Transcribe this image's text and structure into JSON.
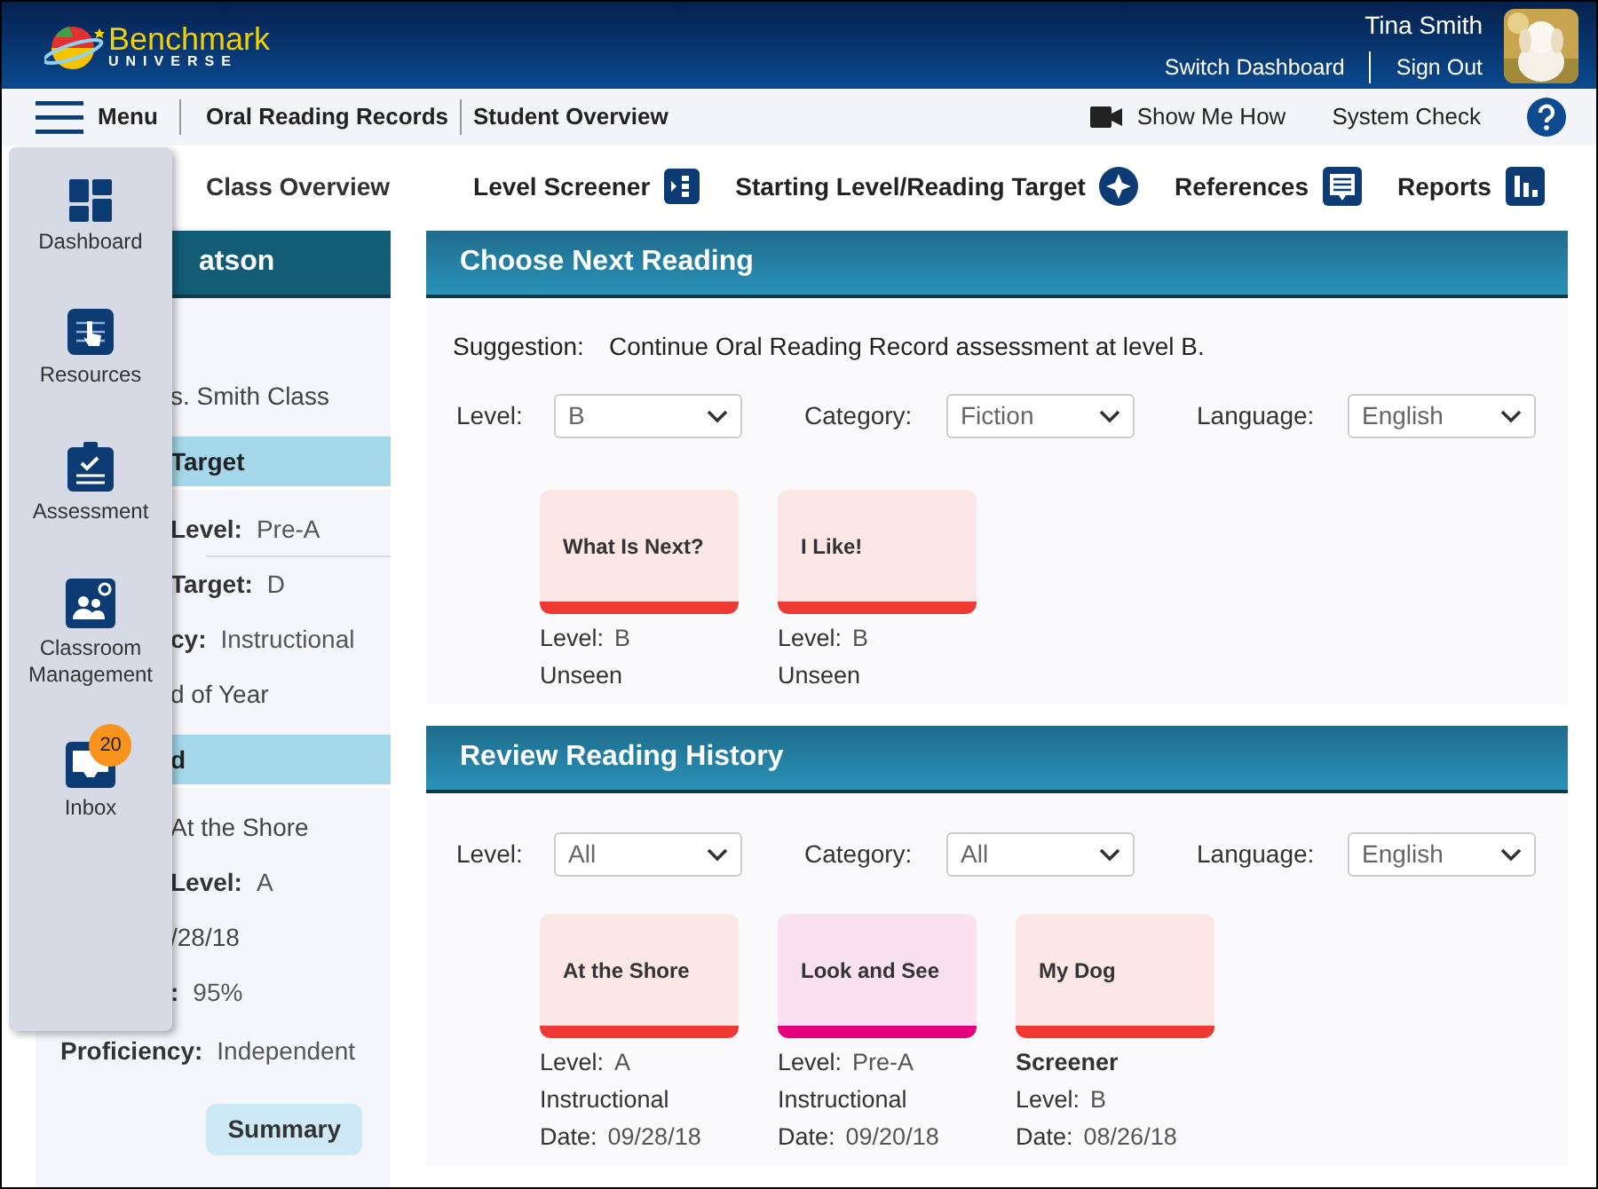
{
  "logo": {
    "word": "Benchmark",
    "subword": "UNIVERSE"
  },
  "user": {
    "name": "Tina Smith",
    "links": [
      "Switch Dashboard",
      "Sign Out"
    ],
    "avatar": {
      "kind": "picture"
    }
  },
  "nav": {
    "menu_label": "Menu",
    "breadcrumbs": [
      "Oral Reading Records",
      "Student Overview"
    ],
    "right": [
      {
        "kind": "video",
        "label": "Show Me How"
      },
      {
        "kind": "plain",
        "label": "System Check"
      },
      {
        "kind": "help"
      }
    ]
  },
  "toolbar": {
    "back": "Class Overview",
    "tools": [
      {
        "label": "Level Screener"
      },
      {
        "label": "Starting Level/Reading Target"
      },
      {
        "label": "References"
      },
      {
        "label": "Reports"
      }
    ]
  },
  "side_menu": [
    {
      "label": "Dashboard"
    },
    {
      "label": "Resources"
    },
    {
      "label": "Assessment"
    },
    {
      "label": "Classroom Management"
    },
    {
      "label": "Inbox",
      "badge": "20"
    }
  ],
  "student_panel": [
    {
      "kind": "header",
      "text": "atson"
    },
    {
      "kind": "text",
      "text": "s. Smith Class"
    },
    {
      "kind": "band",
      "text": "Target"
    },
    {
      "kind": "field",
      "label": "Level:",
      "value": "Pre-A",
      "divider": true
    },
    {
      "kind": "field",
      "label": "Target:",
      "value": "D"
    },
    {
      "kind": "field",
      "label": "cy:",
      "value": "Instructional"
    },
    {
      "kind": "text",
      "text": "d of Year"
    },
    {
      "kind": "band",
      "text": "d"
    },
    {
      "kind": "text",
      "text": "At the Shore"
    },
    {
      "kind": "field",
      "label": "Level:",
      "value": "A"
    },
    {
      "kind": "text",
      "text": "/28/18"
    },
    {
      "kind": "field",
      "label": ":",
      "value": "95%"
    },
    {
      "kind": "field",
      "label": "Proficiency:",
      "value": "Independent",
      "full": true
    },
    {
      "kind": "button",
      "text": "Summary"
    }
  ],
  "sections": [
    {
      "title": "Choose Next Reading",
      "suggestion": {
        "label": "Suggestion:",
        "text": "Continue Oral Reading Record assessment at level B."
      },
      "filters": [
        {
          "label": "Level:",
          "value": "B"
        },
        {
          "label": "Category:",
          "value": "Fiction"
        },
        {
          "label": "Language:",
          "value": "English"
        }
      ],
      "cards": [
        {
          "title": "What Is Next?",
          "color": "#ee3a33",
          "lines": [
            {
              "kind": "field",
              "label": "Level:",
              "value": "B"
            },
            {
              "kind": "plain",
              "text": "Unseen"
            }
          ]
        },
        {
          "title": "I Like!",
          "color": "#ee3a33",
          "lines": [
            {
              "kind": "field",
              "label": "Level:",
              "value": "B"
            },
            {
              "kind": "plain",
              "text": "Unseen"
            }
          ]
        }
      ]
    },
    {
      "title": "Review Reading History",
      "filters": [
        {
          "label": "Level:",
          "value": "All"
        },
        {
          "label": "Category:",
          "value": "All"
        },
        {
          "label": "Language:",
          "value": "English"
        }
      ],
      "cards": [
        {
          "title": "At the Shore",
          "color": "#ee3a33",
          "lines": [
            {
              "kind": "field",
              "label": "Level:",
              "value": "A"
            },
            {
              "kind": "plain",
              "text": "Instructional"
            },
            {
              "kind": "field",
              "label": "Date:",
              "value": "09/28/18"
            }
          ]
        },
        {
          "title": "Look and See",
          "color": "#e5007e",
          "lines": [
            {
              "kind": "field",
              "label": "Level:",
              "value": "Pre-A"
            },
            {
              "kind": "plain",
              "text": "Instructional"
            },
            {
              "kind": "field",
              "label": "Date:",
              "value": "09/20/18"
            }
          ]
        },
        {
          "title": "My Dog",
          "color": "#ee3a33",
          "lines": [
            {
              "kind": "bold",
              "text": "Screener"
            },
            {
              "kind": "field",
              "label": "Level:",
              "value": "B"
            },
            {
              "kind": "field",
              "label": "Date:",
              "value": "08/26/18"
            }
          ]
        }
      ]
    }
  ]
}
